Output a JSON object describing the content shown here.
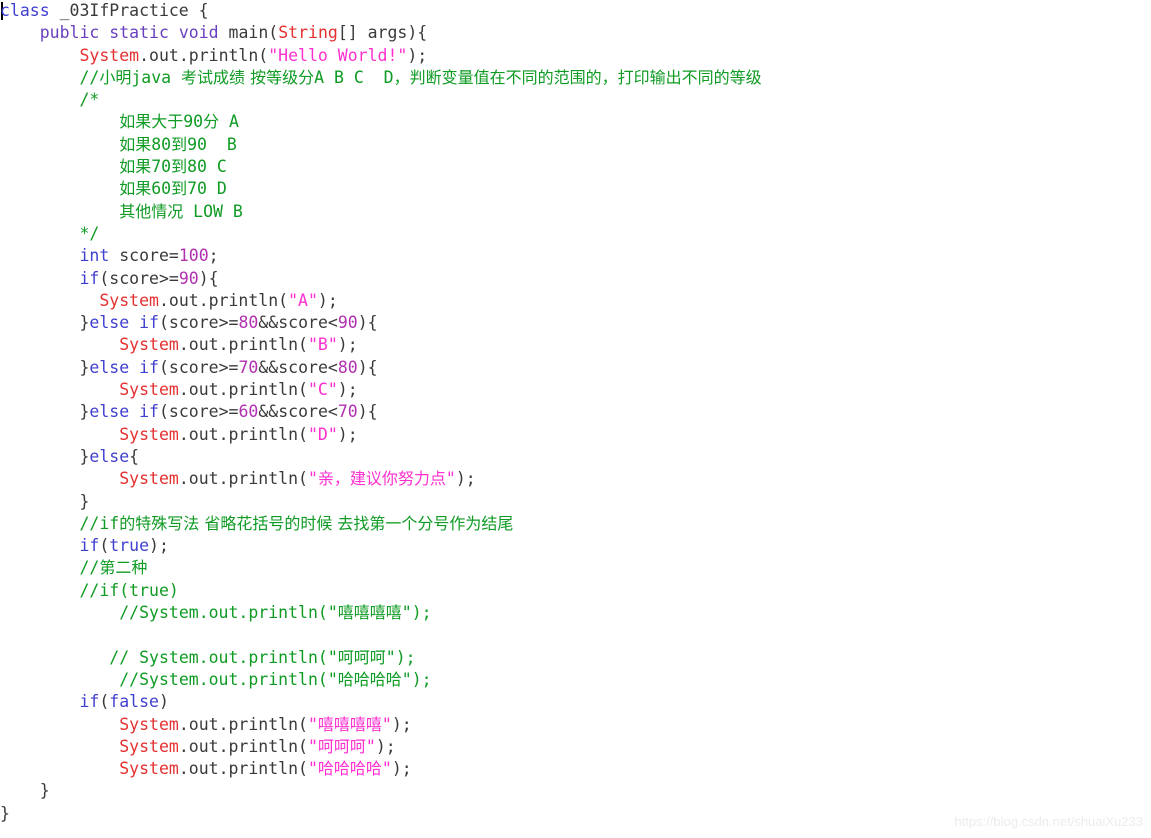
{
  "editor": {
    "language": "java",
    "class_name": "_03IfPractice",
    "background_color": "#ffffff",
    "caret_visible": true,
    "watermark": "https://blog.csdn.net/shuaiXu233",
    "theme_colors": {
      "keyword": "#3f3fd0",
      "keyword_modifier": "#6a3fbf",
      "type": "#e53030",
      "number": "#b030b0",
      "string": "#ff2fd0",
      "comment": "#0f9b24",
      "plain": "#3a3a3a",
      "background": "#ffffff",
      "watermark": "#ececec"
    }
  },
  "code_lines": [
    {
      "n": 1,
      "indent": 0,
      "tokens": [
        {
          "t": "class",
          "c": "kw"
        },
        {
          "t": " _03IfPractice {",
          "c": "plain"
        }
      ]
    },
    {
      "n": 2,
      "indent": 4,
      "tokens": [
        {
          "t": "public",
          "c": "kw2"
        },
        {
          "t": " ",
          "c": "plain"
        },
        {
          "t": "static",
          "c": "kw2"
        },
        {
          "t": " ",
          "c": "plain"
        },
        {
          "t": "void",
          "c": "kw2"
        },
        {
          "t": " main(",
          "c": "plain"
        },
        {
          "t": "String",
          "c": "type"
        },
        {
          "t": "[] args){",
          "c": "plain"
        }
      ]
    },
    {
      "n": 3,
      "indent": 8,
      "tokens": [
        {
          "t": "System",
          "c": "cls"
        },
        {
          "t": ".out.println(",
          "c": "plain"
        },
        {
          "t": "\"Hello World!\"",
          "c": "str"
        },
        {
          "t": ");",
          "c": "plain"
        }
      ]
    },
    {
      "n": 4,
      "indent": 8,
      "tokens": [
        {
          "t": "//",
          "c": "cmt"
        },
        {
          "t": "小明",
          "c": "cmt cmt-cjk"
        },
        {
          "t": "java ",
          "c": "cmt"
        },
        {
          "t": "考试成绩 按等级分",
          "c": "cmt cmt-cjk"
        },
        {
          "t": "A B C  D",
          "c": "cmt"
        },
        {
          "t": "，判断变量值在不同的范围的，打印输出不同的等级",
          "c": "cmt cmt-cjk"
        }
      ]
    },
    {
      "n": 5,
      "indent": 8,
      "tokens": [
        {
          "t": "/*",
          "c": "cmt"
        }
      ]
    },
    {
      "n": 6,
      "indent": 12,
      "tokens": [
        {
          "t": "如果大于",
          "c": "cmt cmt-cjk"
        },
        {
          "t": "90",
          "c": "cmt"
        },
        {
          "t": "分",
          "c": "cmt cmt-cjk"
        },
        {
          "t": " A",
          "c": "cmt"
        }
      ]
    },
    {
      "n": 7,
      "indent": 12,
      "tokens": [
        {
          "t": "如果",
          "c": "cmt cmt-cjk"
        },
        {
          "t": "80",
          "c": "cmt"
        },
        {
          "t": "到",
          "c": "cmt cmt-cjk"
        },
        {
          "t": "90  B",
          "c": "cmt"
        }
      ]
    },
    {
      "n": 8,
      "indent": 12,
      "tokens": [
        {
          "t": "如果",
          "c": "cmt cmt-cjk"
        },
        {
          "t": "70",
          "c": "cmt"
        },
        {
          "t": "到",
          "c": "cmt cmt-cjk"
        },
        {
          "t": "80 C",
          "c": "cmt"
        }
      ]
    },
    {
      "n": 9,
      "indent": 12,
      "tokens": [
        {
          "t": "如果",
          "c": "cmt cmt-cjk"
        },
        {
          "t": "60",
          "c": "cmt"
        },
        {
          "t": "到",
          "c": "cmt cmt-cjk"
        },
        {
          "t": "70 D",
          "c": "cmt"
        }
      ]
    },
    {
      "n": 10,
      "indent": 12,
      "tokens": [
        {
          "t": "其他情况",
          "c": "cmt cmt-cjk"
        },
        {
          "t": " LOW B",
          "c": "cmt"
        }
      ]
    },
    {
      "n": 11,
      "indent": 8,
      "tokens": [
        {
          "t": "*/",
          "c": "cmt"
        }
      ]
    },
    {
      "n": 12,
      "indent": 8,
      "tokens": [
        {
          "t": "int",
          "c": "kw"
        },
        {
          "t": " score=",
          "c": "plain"
        },
        {
          "t": "100",
          "c": "num"
        },
        {
          "t": ";",
          "c": "plain"
        }
      ]
    },
    {
      "n": 13,
      "indent": 8,
      "tokens": [
        {
          "t": "if",
          "c": "kw"
        },
        {
          "t": "(score>=",
          "c": "plain"
        },
        {
          "t": "90",
          "c": "num"
        },
        {
          "t": "){",
          "c": "plain"
        }
      ]
    },
    {
      "n": 14,
      "indent": 10,
      "tokens": [
        {
          "t": "System",
          "c": "cls"
        },
        {
          "t": ".out.println(",
          "c": "plain"
        },
        {
          "t": "\"A\"",
          "c": "str"
        },
        {
          "t": ");",
          "c": "plain"
        }
      ]
    },
    {
      "n": 15,
      "indent": 8,
      "tokens": [
        {
          "t": "}",
          "c": "plain"
        },
        {
          "t": "else",
          "c": "kw"
        },
        {
          "t": " ",
          "c": "plain"
        },
        {
          "t": "if",
          "c": "kw"
        },
        {
          "t": "(score>=",
          "c": "plain"
        },
        {
          "t": "80",
          "c": "num"
        },
        {
          "t": "&&score<",
          "c": "plain"
        },
        {
          "t": "90",
          "c": "num"
        },
        {
          "t": "){",
          "c": "plain"
        }
      ]
    },
    {
      "n": 16,
      "indent": 12,
      "tokens": [
        {
          "t": "System",
          "c": "cls"
        },
        {
          "t": ".out.println(",
          "c": "plain"
        },
        {
          "t": "\"B\"",
          "c": "str"
        },
        {
          "t": ");",
          "c": "plain"
        }
      ]
    },
    {
      "n": 17,
      "indent": 8,
      "tokens": [
        {
          "t": "}",
          "c": "plain"
        },
        {
          "t": "else",
          "c": "kw"
        },
        {
          "t": " ",
          "c": "plain"
        },
        {
          "t": "if",
          "c": "kw"
        },
        {
          "t": "(score>=",
          "c": "plain"
        },
        {
          "t": "70",
          "c": "num"
        },
        {
          "t": "&&score<",
          "c": "plain"
        },
        {
          "t": "80",
          "c": "num"
        },
        {
          "t": "){",
          "c": "plain"
        }
      ]
    },
    {
      "n": 18,
      "indent": 12,
      "tokens": [
        {
          "t": "System",
          "c": "cls"
        },
        {
          "t": ".out.println(",
          "c": "plain"
        },
        {
          "t": "\"C\"",
          "c": "str"
        },
        {
          "t": ");",
          "c": "plain"
        }
      ]
    },
    {
      "n": 19,
      "indent": 8,
      "tokens": [
        {
          "t": "}",
          "c": "plain"
        },
        {
          "t": "else",
          "c": "kw"
        },
        {
          "t": " ",
          "c": "plain"
        },
        {
          "t": "if",
          "c": "kw"
        },
        {
          "t": "(score>=",
          "c": "plain"
        },
        {
          "t": "60",
          "c": "num"
        },
        {
          "t": "&&score<",
          "c": "plain"
        },
        {
          "t": "70",
          "c": "num"
        },
        {
          "t": "){",
          "c": "plain"
        }
      ]
    },
    {
      "n": 20,
      "indent": 12,
      "tokens": [
        {
          "t": "System",
          "c": "cls"
        },
        {
          "t": ".out.println(",
          "c": "plain"
        },
        {
          "t": "\"D\"",
          "c": "str"
        },
        {
          "t": ");",
          "c": "plain"
        }
      ]
    },
    {
      "n": 21,
      "indent": 8,
      "tokens": [
        {
          "t": "}",
          "c": "plain"
        },
        {
          "t": "else",
          "c": "kw"
        },
        {
          "t": "{",
          "c": "plain"
        }
      ]
    },
    {
      "n": 22,
      "indent": 12,
      "tokens": [
        {
          "t": "System",
          "c": "cls"
        },
        {
          "t": ".out.println(",
          "c": "plain"
        },
        {
          "t": "\"",
          "c": "str"
        },
        {
          "t": "亲，建议你努力点",
          "c": "str str-cjk"
        },
        {
          "t": "\"",
          "c": "str"
        },
        {
          "t": ");",
          "c": "plain"
        }
      ]
    },
    {
      "n": 23,
      "indent": 8,
      "tokens": [
        {
          "t": "}",
          "c": "plain"
        }
      ]
    },
    {
      "n": 24,
      "indent": 8,
      "tokens": [
        {
          "t": "//if",
          "c": "cmt"
        },
        {
          "t": "的特殊写法 省略花括号的时候 去找第一个分号作为结尾",
          "c": "cmt cmt-cjk"
        }
      ]
    },
    {
      "n": 25,
      "indent": 8,
      "tokens": [
        {
          "t": "if",
          "c": "kw"
        },
        {
          "t": "(",
          "c": "plain"
        },
        {
          "t": "true",
          "c": "kw"
        },
        {
          "t": ");",
          "c": "plain"
        }
      ]
    },
    {
      "n": 26,
      "indent": 8,
      "tokens": [
        {
          "t": "//",
          "c": "cmt"
        },
        {
          "t": "第二种",
          "c": "cmt cmt-cjk"
        }
      ]
    },
    {
      "n": 27,
      "indent": 8,
      "tokens": [
        {
          "t": "//if(true)",
          "c": "cmt"
        }
      ]
    },
    {
      "n": 28,
      "indent": 12,
      "tokens": [
        {
          "t": "//System.out.println(\"",
          "c": "cmt"
        },
        {
          "t": "嘻嘻嘻嘻",
          "c": "cmt cmt-cjk"
        },
        {
          "t": "\");",
          "c": "cmt"
        }
      ]
    },
    {
      "n": 29,
      "indent": 0,
      "tokens": []
    },
    {
      "n": 30,
      "indent": 11,
      "tokens": [
        {
          "t": "// System.out.println(\"",
          "c": "cmt"
        },
        {
          "t": "呵呵呵",
          "c": "cmt cmt-cjk"
        },
        {
          "t": "\");",
          "c": "cmt"
        }
      ]
    },
    {
      "n": 31,
      "indent": 12,
      "tokens": [
        {
          "t": "//System.out.println(\"",
          "c": "cmt"
        },
        {
          "t": "哈哈哈哈",
          "c": "cmt cmt-cjk"
        },
        {
          "t": "\");",
          "c": "cmt"
        }
      ]
    },
    {
      "n": 32,
      "indent": 8,
      "tokens": [
        {
          "t": "if",
          "c": "kw"
        },
        {
          "t": "(",
          "c": "plain"
        },
        {
          "t": "false",
          "c": "kw"
        },
        {
          "t": ")",
          "c": "plain"
        }
      ]
    },
    {
      "n": 33,
      "indent": 12,
      "tokens": [
        {
          "t": "System",
          "c": "cls"
        },
        {
          "t": ".out.println(",
          "c": "plain"
        },
        {
          "t": "\"",
          "c": "str"
        },
        {
          "t": "嘻嘻嘻嘻",
          "c": "str str-cjk"
        },
        {
          "t": "\"",
          "c": "str"
        },
        {
          "t": ");",
          "c": "plain"
        }
      ]
    },
    {
      "n": 34,
      "indent": 12,
      "tokens": [
        {
          "t": "System",
          "c": "cls"
        },
        {
          "t": ".out.println(",
          "c": "plain"
        },
        {
          "t": "\"",
          "c": "str"
        },
        {
          "t": "呵呵呵",
          "c": "str str-cjk"
        },
        {
          "t": "\"",
          "c": "str"
        },
        {
          "t": ");",
          "c": "plain"
        }
      ]
    },
    {
      "n": 35,
      "indent": 12,
      "tokens": [
        {
          "t": "System",
          "c": "cls"
        },
        {
          "t": ".out.println(",
          "c": "plain"
        },
        {
          "t": "\"",
          "c": "str"
        },
        {
          "t": "哈哈哈哈",
          "c": "str str-cjk"
        },
        {
          "t": "\"",
          "c": "str"
        },
        {
          "t": ");",
          "c": "plain"
        }
      ]
    },
    {
      "n": 36,
      "indent": 4,
      "tokens": [
        {
          "t": "}",
          "c": "plain"
        }
      ]
    },
    {
      "n": 37,
      "indent": 0,
      "tokens": [
        {
          "t": "}",
          "c": "plain"
        }
      ]
    }
  ]
}
